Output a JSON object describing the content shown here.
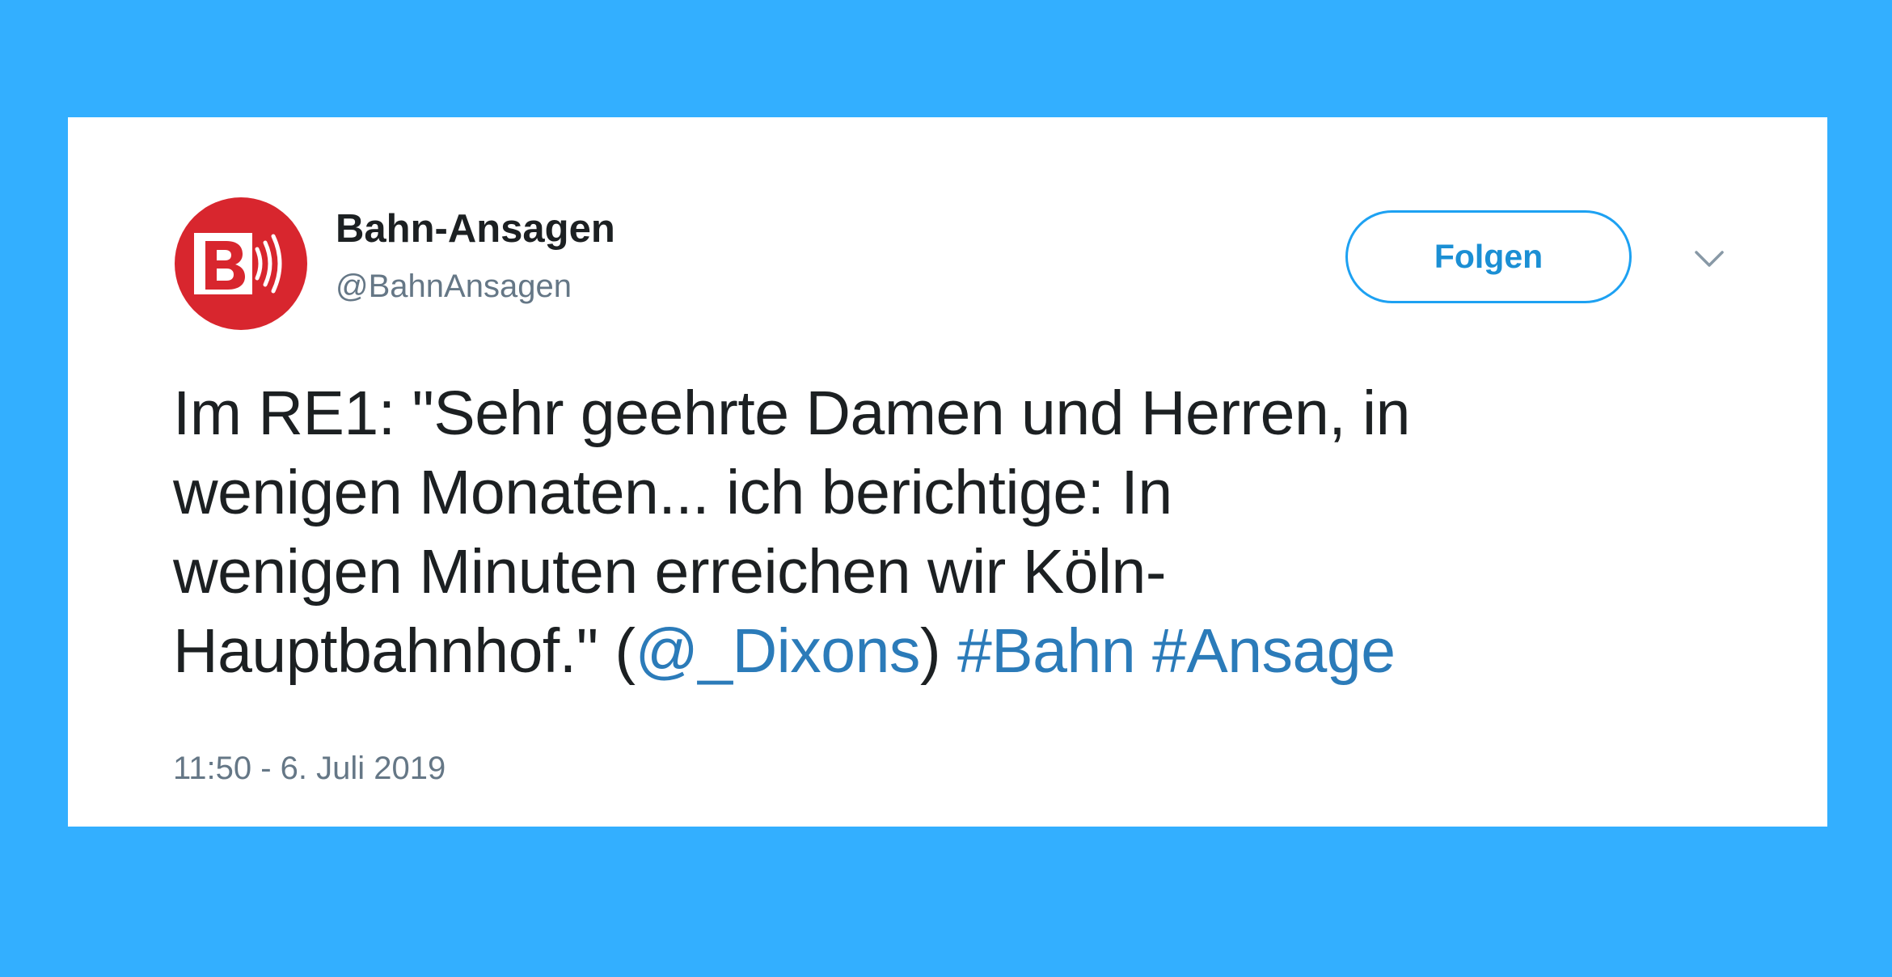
{
  "tweet": {
    "display_name": "Bahn-Ansagen",
    "handle": "@BahnAnsagen",
    "follow_label": "Folgen",
    "menu_icon": "chevron-down-icon",
    "avatar_icon": "bahn-ansagen-logo",
    "text": {
      "line1": "Im RE1: \"Sehr geehrte Damen und Herren, in",
      "line2": "wenigen Monaten... ich berichtige: In",
      "line3": "wenigen Minuten erreichen wir Köln-",
      "line4_before": "Hauptbahnhof.\" (",
      "mention": "@_Dixons",
      "line4_after": ") ",
      "hashtag1": "#Bahn",
      "hashtag2": "#Ansage"
    },
    "timestamp": "11:50 - 6. Juli 2019"
  },
  "colors": {
    "background": "#33afff",
    "card": "#ffffff",
    "link": "#2b7bb9",
    "follow_border": "#1da1f2",
    "logo_red": "#d8262e"
  }
}
